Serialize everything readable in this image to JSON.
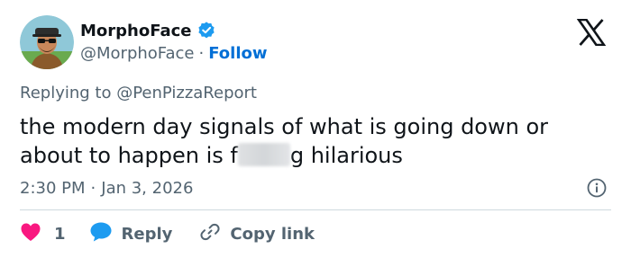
{
  "author": {
    "display_name": "MorphoFace",
    "handle": "@MorphoFace",
    "separator": "·",
    "follow_label": "Follow",
    "verified_icon": "verified-badge-icon"
  },
  "platform_logo": "x-logo-icon",
  "reply_context": {
    "prefix": "Replying to",
    "mention": "@PenPizzaReport"
  },
  "tweet": {
    "text_part1": "the modern day signals of what is going down or about to happen is f",
    "text_part2": "g hilarious",
    "timestamp_time": "2:30 PM",
    "timestamp_sep": "·",
    "timestamp_date": "Jan 3, 2026"
  },
  "actions": {
    "like_count": "1",
    "reply_label": "Reply",
    "copy_label": "Copy link"
  },
  "colors": {
    "accent": "#1d9bf0",
    "link": "#006fd6",
    "like": "#f91880",
    "muted": "#536471",
    "text": "#0f1419"
  }
}
